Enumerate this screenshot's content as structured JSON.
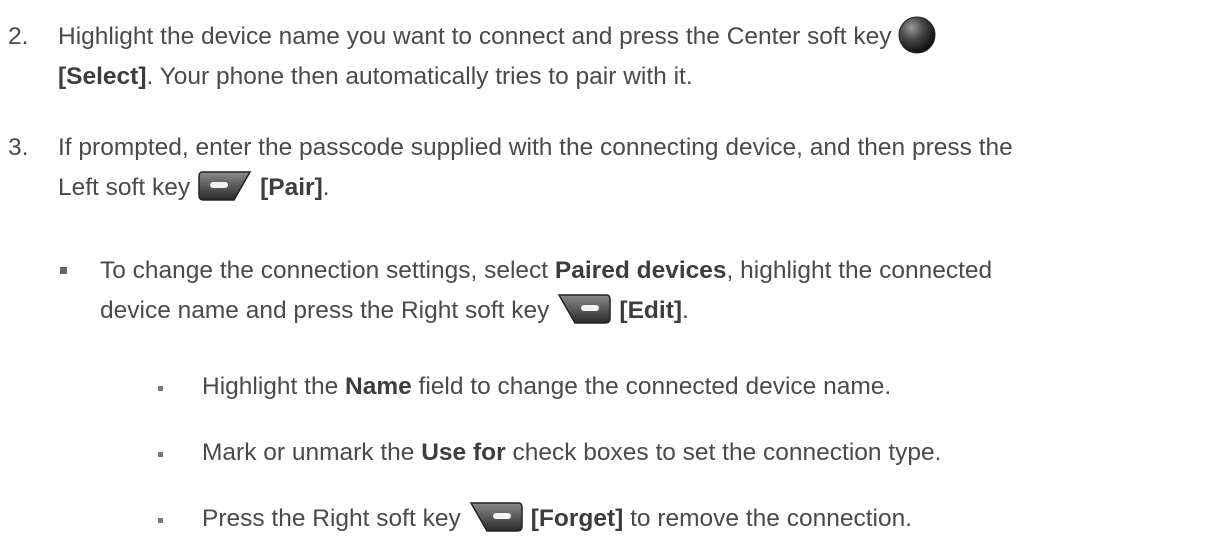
{
  "steps": [
    {
      "number": "2.",
      "line1_text": "Highlight the device name you want to connect and press the Center soft key",
      "line2_bold": "[Select]",
      "line2_text": ". Your phone then automatically tries to pair with it.",
      "icon": "center-soft-key-icon"
    },
    {
      "number": "3.",
      "line1_text": "If prompted, enter the passcode supplied with the connecting device, and then press the",
      "line2_text": "Left soft key",
      "line2_bold": "[Pair]",
      "line2_end": ".",
      "icon": "left-soft-key-icon"
    }
  ],
  "bullet": {
    "t1": "To change the connection settings, select ",
    "b1": "Paired devices",
    "t2": ", highlight the connected",
    "t3": "device name and press the Right soft key",
    "b2": "[Edit]",
    "t4": ".",
    "icon": "right-soft-key-icon"
  },
  "subitems": [
    {
      "t1": "Highlight the ",
      "b1": "Name",
      "t2": " field to change the connected device name."
    },
    {
      "t1": "Mark or unmark the ",
      "b1": "Use for",
      "t2": " check boxes to set the connection type."
    },
    {
      "t1": "Press the Right soft key",
      "b1": "[Forget]",
      "t2": " to remove the connection.",
      "icon": "right-soft-key-icon"
    }
  ],
  "colors": {
    "text": "#4a4a4a",
    "icon_dark": "#2b2b2b",
    "icon_light": "#9a9a9a"
  }
}
